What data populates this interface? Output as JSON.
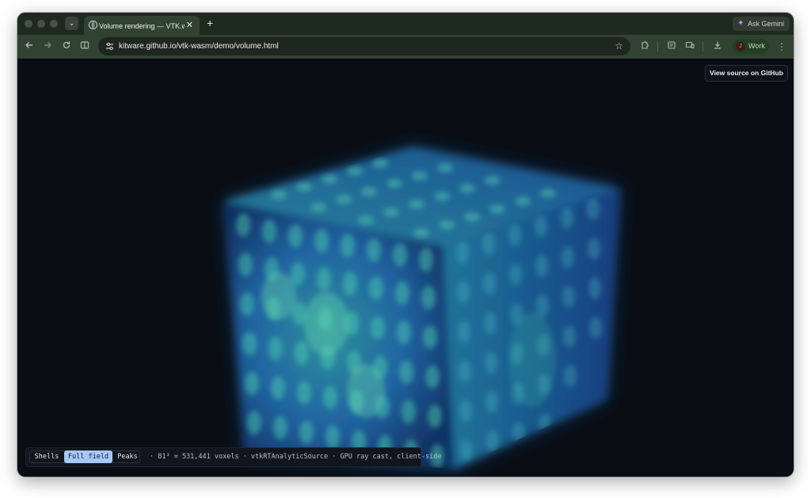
{
  "browser": {
    "tab": {
      "title": "Volume rendering — VTK.wasm",
      "close_glyph": "✕"
    },
    "new_tab_glyph": "+",
    "tab_search_glyph": "⌄",
    "ask_gemini": {
      "label": "Ask Gemini",
      "icon": "gemini-spark-icon"
    },
    "address": {
      "url": "kitware.github.io/vtk-wasm/demo/volume.html"
    },
    "profile": {
      "initial": "J",
      "label": "Work"
    },
    "nav_icons": [
      "back-icon",
      "forward-icon",
      "reload-icon",
      "side-panel-icon"
    ],
    "toolbar_icons": [
      "extensions-icon",
      "reading-list-icon",
      "cast-icon",
      "download-icon",
      "more-menu-icon"
    ],
    "colors": {
      "tab_strip": "#1f2a1f",
      "toolbar": "#324232",
      "omnibox": "#1d271d"
    }
  },
  "page": {
    "github_button": "View source on GitHub",
    "view_modes": [
      {
        "label": "Shells",
        "active": false
      },
      {
        "label": "Full field",
        "active": true
      },
      {
        "label": "Peaks",
        "active": false
      }
    ],
    "info": "· 81³ = 531,441 voxels · vtkRTAnalyticSource · GPU ray cast, client-side",
    "colors": {
      "background": "#090d14",
      "active_mode": "#a7c7f7",
      "volume_low": "#1d4f8f",
      "volume_high": "#3fc8a6"
    }
  }
}
